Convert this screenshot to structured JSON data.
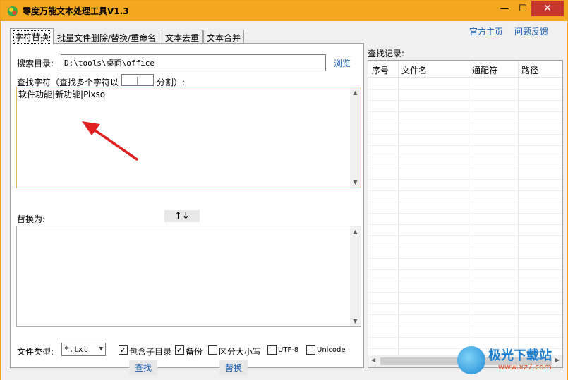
{
  "window": {
    "title": "零度万能文本处理工具V1.3",
    "minimize": "—",
    "maximize": "☐",
    "close": "✕"
  },
  "tabs": [
    {
      "label": "字符替换",
      "active": true
    },
    {
      "label": "批量文件删除/替换/重命名",
      "active": false
    },
    {
      "label": "文本去重",
      "active": false
    },
    {
      "label": "文本合并",
      "active": false
    }
  ],
  "top_links": {
    "homepage": "官方主页",
    "feedback": "问题反馈"
  },
  "search_dir": {
    "label": "搜索目录:",
    "value": "D:\\tools\\桌面\\office",
    "browse": "浏览"
  },
  "find": {
    "label_prefix": "查找字符（查找多个字符以",
    "separator_value": "|",
    "label_suffix": "分割）:",
    "text": "软件功能|新功能|Pixso"
  },
  "replace": {
    "label": "替换为:",
    "swap": "↑↓",
    "text": ""
  },
  "options": {
    "file_type_label": "文件类型:",
    "file_type_value": "*.txt",
    "include_subdirs": {
      "label": "包含子目录",
      "checked": true
    },
    "backup": {
      "label": "备份",
      "checked": true
    },
    "case_sensitive": {
      "label": "区分大小写",
      "checked": false
    },
    "utf8": {
      "label": "UTF-8",
      "checked": false
    },
    "unicode": {
      "label": "Unicode",
      "checked": false
    }
  },
  "actions": {
    "find": "查找",
    "replace": "替换"
  },
  "records": {
    "label": "查找记录:",
    "columns": [
      "序号",
      "文件名",
      "通配符",
      "路径"
    ]
  },
  "watermark": {
    "title": "极光下载站",
    "url": "www.xz7.com"
  },
  "colors": {
    "titlebar": "#f2a91f",
    "link": "#1a5fb4",
    "close_button": "#c7372e",
    "arrow": "#e02020"
  }
}
